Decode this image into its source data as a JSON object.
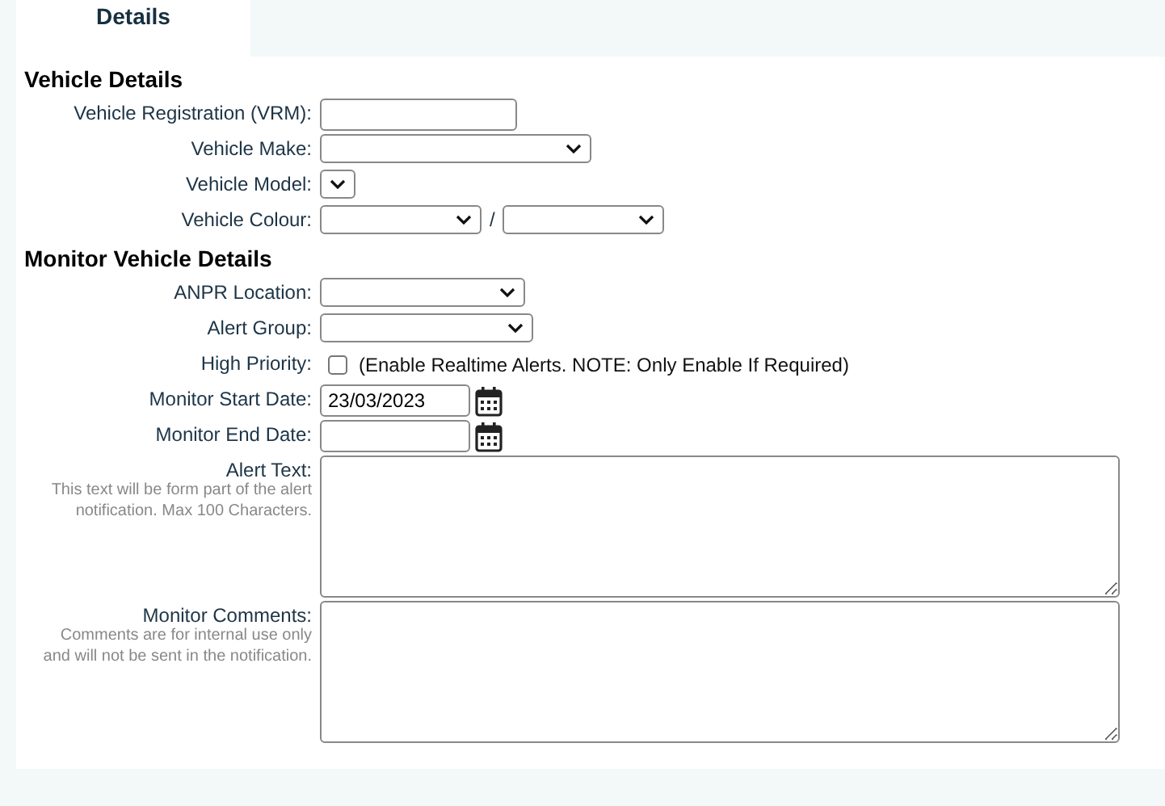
{
  "tabs": [
    {
      "label": "Details",
      "selected": true
    }
  ],
  "sections": [
    {
      "heading": "Vehicle Details",
      "rows": [
        {
          "kind": "text",
          "label": "Vehicle Registration (VRM):",
          "value": ""
        },
        {
          "kind": "select",
          "label": "Vehicle Make:"
        },
        {
          "kind": "select",
          "label": "Vehicle Model:"
        },
        {
          "kind": "select-pair",
          "label": "Vehicle Colour:",
          "separator": "/"
        }
      ]
    },
    {
      "heading": "Monitor Vehicle Details",
      "rows": [
        {
          "kind": "select",
          "label": "ANPR Location:"
        },
        {
          "kind": "select",
          "label": "Alert Group:"
        },
        {
          "kind": "checkbox",
          "label": "High Priority:",
          "checked": false,
          "note": "(Enable Realtime Alerts. NOTE: Only Enable If Required)"
        },
        {
          "kind": "date",
          "label": "Monitor Start Date:",
          "value": "23/03/2023"
        },
        {
          "kind": "date",
          "label": "Monitor End Date:",
          "value": ""
        },
        {
          "kind": "textarea",
          "label": "Alert Text:",
          "hint": "This text will be form part of the alert notification. Max 100 Characters."
        },
        {
          "kind": "textarea",
          "label": "Monitor Comments:",
          "hint": "Comments are for internal use only and will not be sent in the notification."
        }
      ]
    }
  ]
}
